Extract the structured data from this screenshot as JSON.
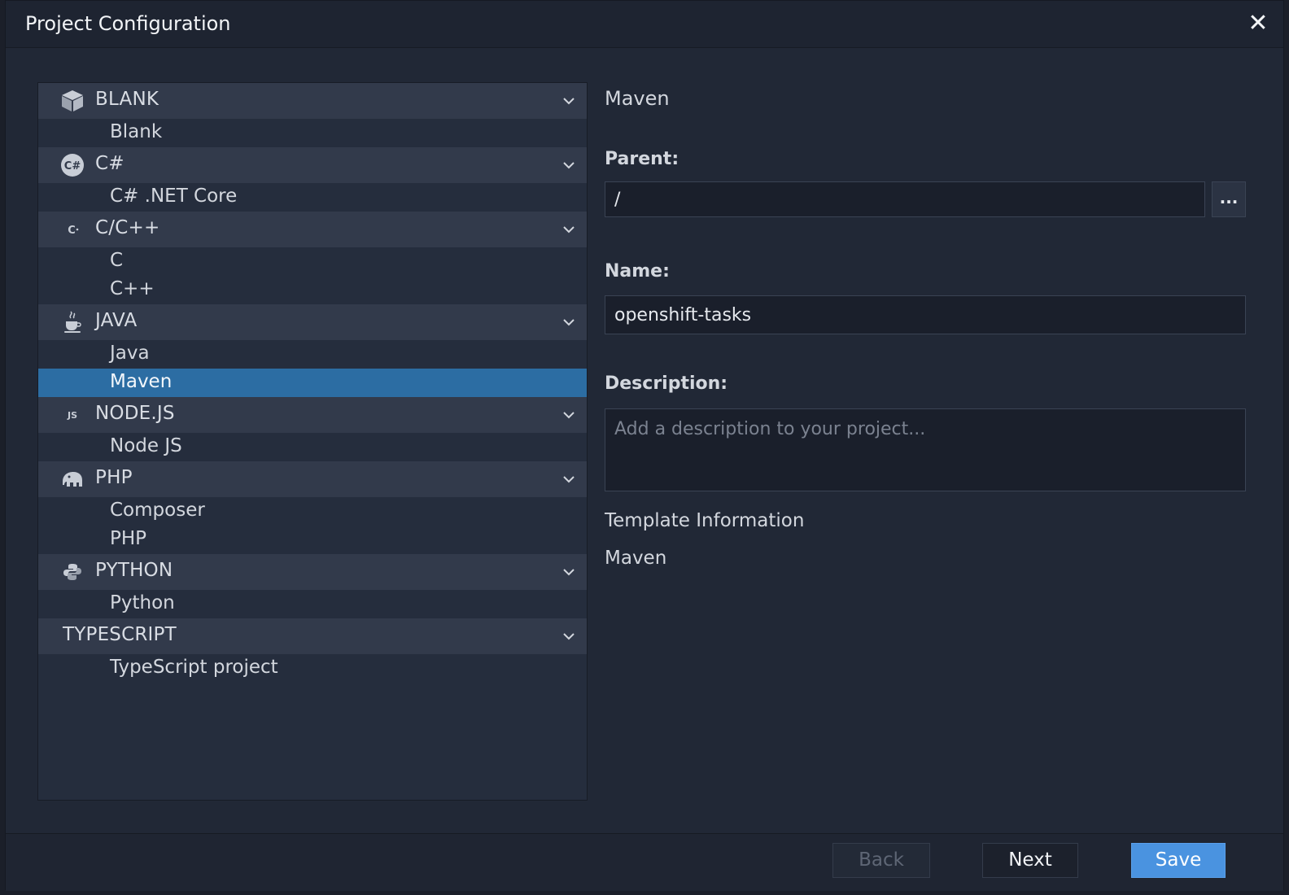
{
  "window": {
    "title": "Project Configuration",
    "close_icon": "close-icon"
  },
  "tree": {
    "groups": [
      {
        "label": "BLANK",
        "icon": "cube-icon",
        "items": [
          "Blank"
        ]
      },
      {
        "label": "C#",
        "icon": "csharp-icon",
        "icon_text": "C#",
        "items": [
          "C# .NET Core"
        ]
      },
      {
        "label": "C/C++",
        "icon": "c-icon",
        "icon_text": "C",
        "items": [
          "C",
          "C++"
        ]
      },
      {
        "label": "JAVA",
        "icon": "java-cup-icon",
        "items": [
          "Java",
          "Maven"
        ]
      },
      {
        "label": "NODE.JS",
        "icon": "js-icon",
        "icon_text": "JS",
        "items": [
          "Node JS"
        ]
      },
      {
        "label": "PHP",
        "icon": "elephant-icon",
        "items": [
          "Composer",
          "PHP"
        ]
      },
      {
        "label": "PYTHON",
        "icon": "python-icon",
        "items": [
          "Python"
        ]
      },
      {
        "label": "TYPESCRIPT",
        "icon": "",
        "items": [
          "TypeScript project"
        ]
      }
    ],
    "selected_item": "Maven"
  },
  "form": {
    "heading": "Maven",
    "parent_label": "Parent:",
    "parent_value": "/",
    "browse_label": "...",
    "name_label": "Name:",
    "name_value": "openshift-tasks",
    "description_label": "Description:",
    "description_value": "",
    "description_placeholder": "Add a description to your project...",
    "template_info_label": "Template Information",
    "template_info_value": "Maven"
  },
  "footer": {
    "back_label": "Back",
    "next_label": "Next",
    "save_label": "Save"
  },
  "colors": {
    "selection": "#2c6da3",
    "save_button": "#4a93e0",
    "background": "#212836"
  }
}
